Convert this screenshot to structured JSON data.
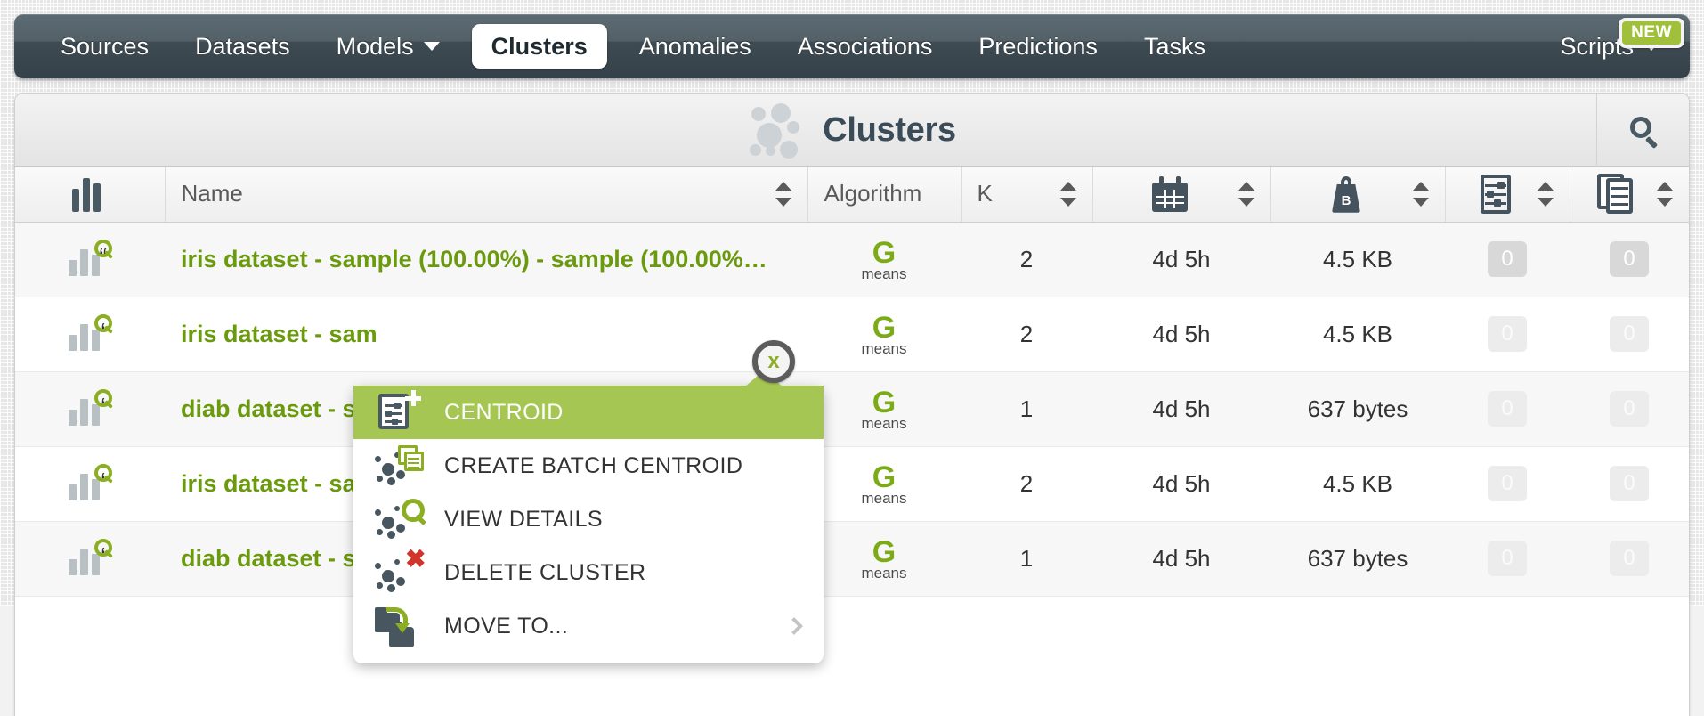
{
  "nav": {
    "items": [
      {
        "label": "Sources",
        "active": false,
        "caret": false
      },
      {
        "label": "Datasets",
        "active": false,
        "caret": false
      },
      {
        "label": "Models",
        "active": false,
        "caret": true
      },
      {
        "label": "Clusters",
        "active": true,
        "caret": false
      },
      {
        "label": "Anomalies",
        "active": false,
        "caret": false
      },
      {
        "label": "Associations",
        "active": false,
        "caret": false
      },
      {
        "label": "Predictions",
        "active": false,
        "caret": false
      },
      {
        "label": "Tasks",
        "active": false,
        "caret": false
      }
    ],
    "scripts_label": "Scripts",
    "new_badge": "NEW"
  },
  "header": {
    "title": "Clusters",
    "search_icon": "search-icon"
  },
  "table": {
    "columns": [
      {
        "key": "type",
        "label": "",
        "icon": "bar-chart-icon",
        "sortable": false
      },
      {
        "key": "name",
        "label": "Name",
        "icon": "",
        "sortable": true
      },
      {
        "key": "algorithm",
        "label": "Algorithm",
        "icon": "",
        "sortable": false
      },
      {
        "key": "k",
        "label": "K",
        "icon": "",
        "sortable": true
      },
      {
        "key": "age",
        "label": "",
        "icon": "calendar-icon",
        "sortable": true
      },
      {
        "key": "size",
        "label": "",
        "icon": "weight-icon",
        "sortable": true
      },
      {
        "key": "centroids",
        "label": "",
        "icon": "centroid-icon",
        "sortable": true
      },
      {
        "key": "batch",
        "label": "",
        "icon": "batch-centroid-icon",
        "sortable": true
      }
    ],
    "rows": [
      {
        "name": "iris dataset - sample (100.00%) - sample (100.00%…",
        "algorithm_g": "G",
        "algorithm_m": "means",
        "k": "2",
        "age": "4d 5h",
        "size": "4.5 KB",
        "centroids": "0",
        "batch": "0"
      },
      {
        "name": "iris dataset - sam",
        "algorithm_g": "G",
        "algorithm_m": "means",
        "k": "2",
        "age": "4d 5h",
        "size": "4.5 KB",
        "centroids": "0",
        "batch": "0"
      },
      {
        "name": "diab dataset - sa",
        "algorithm_g": "G",
        "algorithm_m": "means",
        "k": "1",
        "age": "4d 5h",
        "size": "637 bytes",
        "centroids": "0",
        "batch": "0"
      },
      {
        "name": "iris dataset - sam",
        "algorithm_g": "G",
        "algorithm_m": "means",
        "k": "2",
        "age": "4d 5h",
        "size": "4.5 KB",
        "centroids": "0",
        "batch": "0"
      },
      {
        "name": "diab dataset - sa",
        "algorithm_g": "G",
        "algorithm_m": "means",
        "k": "1",
        "age": "4d 5h",
        "size": "637 bytes",
        "centroids": "0",
        "batch": "0"
      }
    ]
  },
  "close_button": {
    "label": "x"
  },
  "context_menu": {
    "items": [
      {
        "label": "CENTROID",
        "icon": "centroid-plus-icon",
        "highlighted": true,
        "submenu": false
      },
      {
        "label": "CREATE BATCH CENTROID",
        "icon": "batch-centroid-icon",
        "highlighted": false,
        "submenu": false
      },
      {
        "label": "VIEW DETAILS",
        "icon": "cluster-search-icon",
        "highlighted": false,
        "submenu": false
      },
      {
        "label": "DELETE CLUSTER",
        "icon": "cluster-delete-icon",
        "highlighted": false,
        "submenu": false
      },
      {
        "label": "MOVE TO...",
        "icon": "move-folder-icon",
        "highlighted": false,
        "submenu": true
      }
    ]
  },
  "colors": {
    "accent_green": "#8cae22",
    "highlight_green": "#a6c653",
    "nav_dark": "#3f4b52",
    "link_green": "#6b9a0f",
    "delete_red": "#d0342c"
  }
}
